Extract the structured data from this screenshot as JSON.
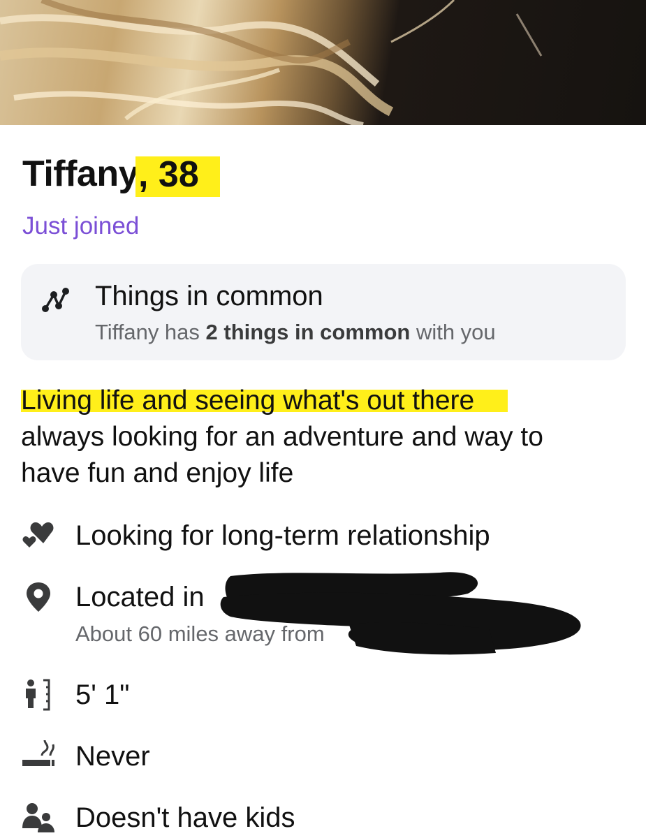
{
  "profile": {
    "name": "Tiffany",
    "age": ", 38",
    "status": "Just joined"
  },
  "common": {
    "icon": "connection-icon",
    "title": "Things in common",
    "sub_prefix": "Tiffany has ",
    "sub_bold": "2 things in common",
    "sub_suffix": " with you"
  },
  "bio": {
    "line1": "Living life and seeing what's out there",
    "line2": "always looking for an adventure and way to",
    "line3": "have fun and enjoy life"
  },
  "details": {
    "looking_for": {
      "icon": "hearts-icon",
      "text": "Looking for long-term relationship"
    },
    "location": {
      "icon": "location-pin-icon",
      "text": "Located in",
      "sub": "About 60 miles away from"
    },
    "height": {
      "icon": "height-icon",
      "text": "5' 1\""
    },
    "smoking": {
      "icon": "smoking-icon",
      "text": "Never"
    },
    "kids": {
      "icon": "kids-icon",
      "text": "Doesn't have kids"
    }
  },
  "colors": {
    "highlight": "#ffef1a",
    "status_purple": "#7b4fd6",
    "secondary_text": "#65676b",
    "card_bg": "#f3f4f7"
  }
}
